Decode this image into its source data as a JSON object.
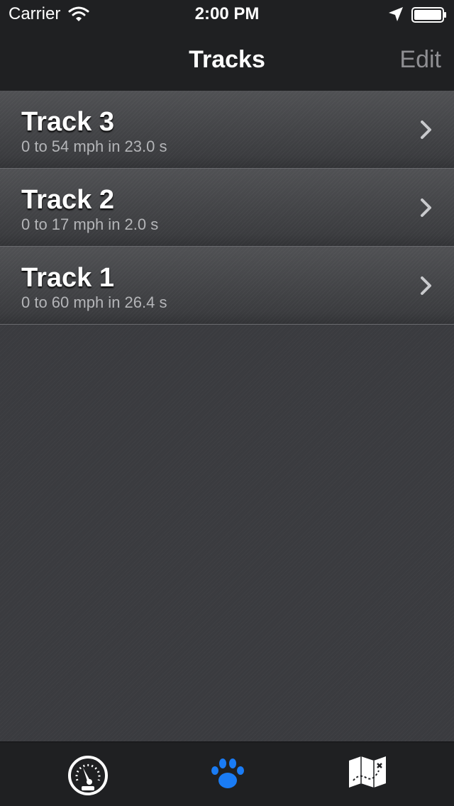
{
  "status_bar": {
    "carrier": "Carrier",
    "time": "2:00 PM",
    "icons": [
      "wifi-icon",
      "location-arrow-icon",
      "battery-icon"
    ]
  },
  "nav": {
    "title": "Tracks",
    "edit_label": "Edit"
  },
  "tracks": [
    {
      "title": "Track 3",
      "subtitle": "0 to 54 mph in 23.0 s"
    },
    {
      "title": "Track 2",
      "subtitle": "0 to 17 mph in 2.0 s"
    },
    {
      "title": "Track 1",
      "subtitle": "0 to 60 mph in 26.4 s"
    }
  ],
  "tabs": [
    {
      "icon": "speedometer-icon",
      "selected": false
    },
    {
      "icon": "paw-icon",
      "selected": true
    },
    {
      "icon": "map-icon",
      "selected": false
    }
  ],
  "colors": {
    "accent": "#1a7cf5",
    "nav_background": "#1f2022",
    "content_background": "#3a3b3f",
    "edit_text": "#8e8e92"
  }
}
